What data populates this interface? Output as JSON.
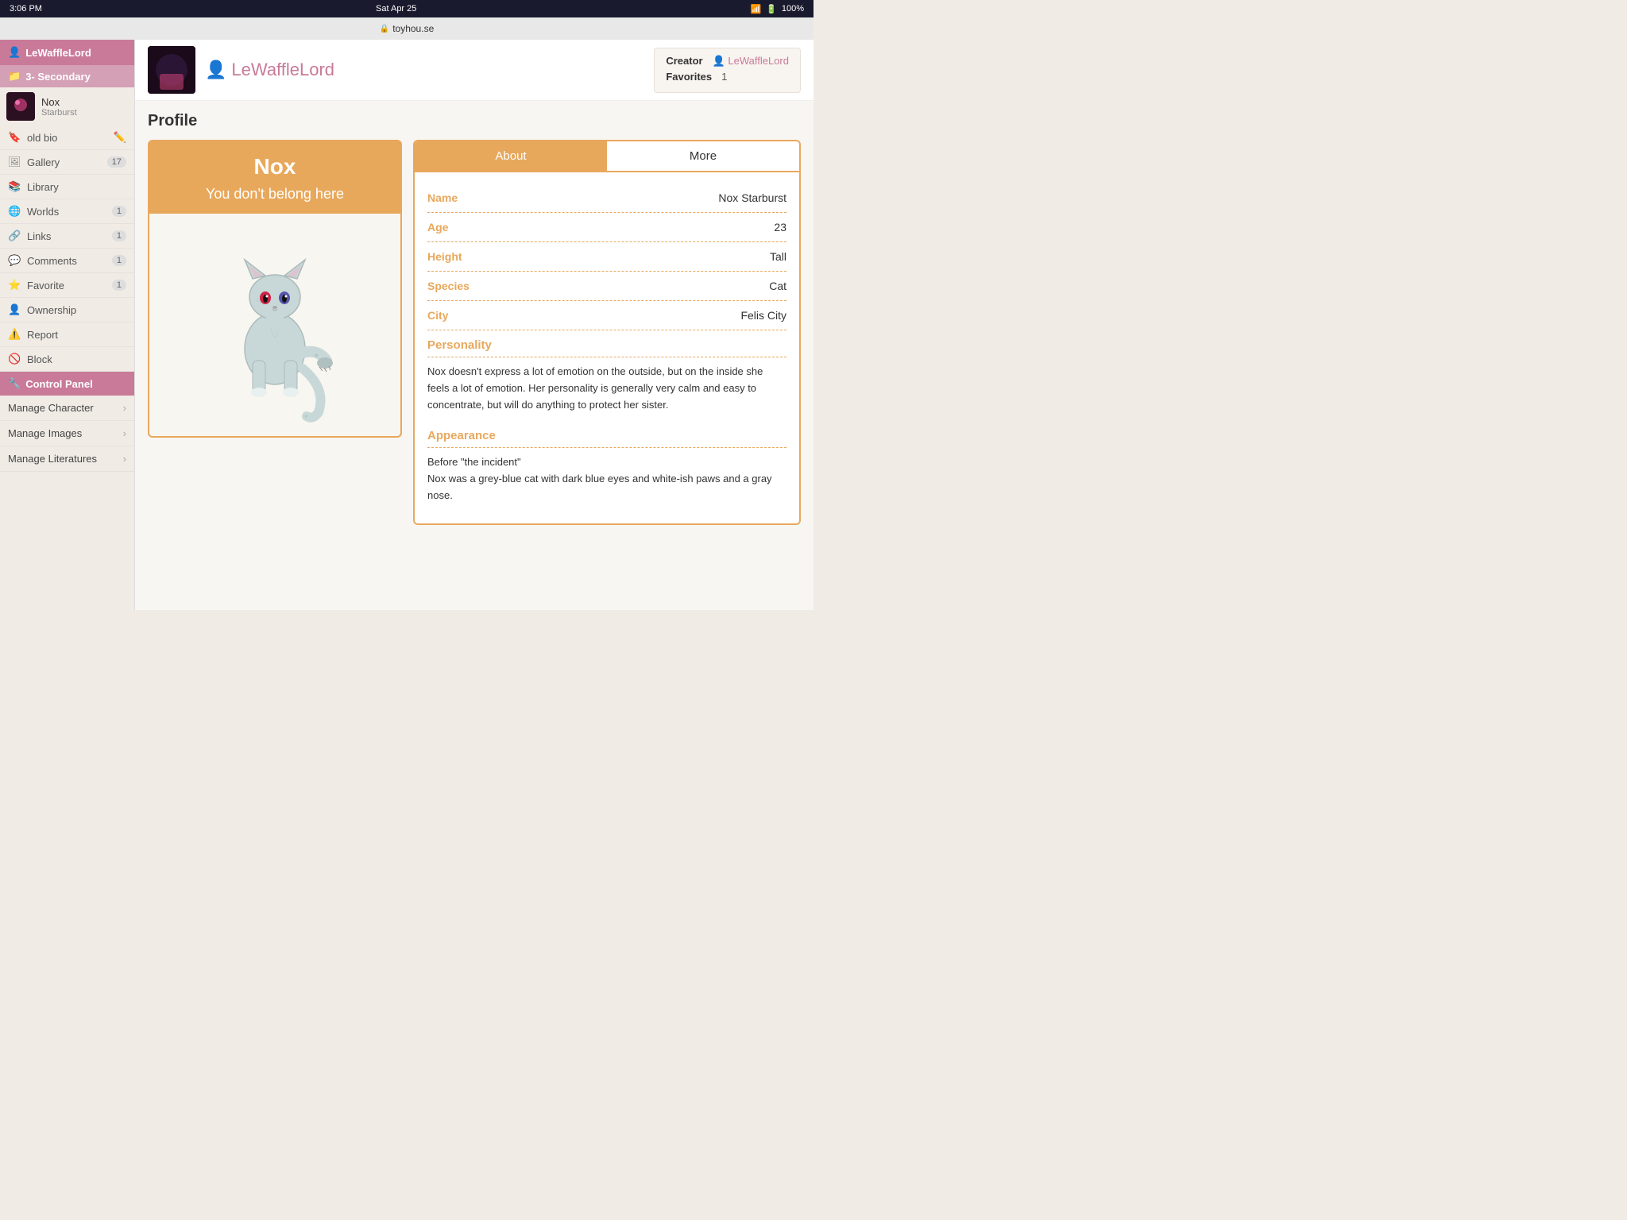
{
  "statusBar": {
    "time": "3:06 PM",
    "date": "Sat Apr 25",
    "battery": "100%",
    "domain": "toyhou.se"
  },
  "sidebar": {
    "username": "LeWaffleLord",
    "folder": "3- Secondary",
    "character": {
      "name": "Nox",
      "subtext": "Starburst"
    },
    "navItems": [
      {
        "icon": "🔖",
        "label": "old bio",
        "badge": "",
        "hasEdit": true
      },
      {
        "icon": "🖼",
        "label": "Gallery",
        "badge": "17"
      },
      {
        "icon": "📚",
        "label": "Library",
        "badge": ""
      },
      {
        "icon": "🌐",
        "label": "Worlds",
        "badge": "1"
      },
      {
        "icon": "🔗",
        "label": "Links",
        "badge": "1"
      },
      {
        "icon": "💬",
        "label": "Comments",
        "badge": "1"
      },
      {
        "icon": "⭐",
        "label": "Favorite",
        "badge": "1"
      },
      {
        "icon": "👤",
        "label": "Ownership",
        "badge": ""
      },
      {
        "icon": "⚠",
        "label": "Report",
        "badge": ""
      },
      {
        "icon": "🚫",
        "label": "Block",
        "badge": ""
      }
    ],
    "controlPanel": {
      "label": "Control Panel",
      "items": [
        {
          "label": "Manage Character"
        },
        {
          "label": "Manage Images"
        },
        {
          "label": "Manage Literatures"
        }
      ]
    }
  },
  "charHeader": {
    "name": "LeWaffleLord",
    "creator": "LeWaffleLord",
    "favorites": "1"
  },
  "profile": {
    "title": "Profile",
    "banner": {
      "charName": "Nox",
      "tagline": "You don't belong here"
    },
    "tabs": {
      "about": "About",
      "more": "More"
    },
    "fields": [
      {
        "label": "Name",
        "value": "Nox Starburst"
      },
      {
        "label": "Age",
        "value": "23"
      },
      {
        "label": "Height",
        "value": "Tall"
      },
      {
        "label": "Species",
        "value": "Cat"
      },
      {
        "label": "City",
        "value": "Felis City"
      }
    ],
    "sections": [
      {
        "header": "Personality",
        "text": "Nox doesn't express a lot of emotion on the outside, but on the inside she feels a lot of emotion. Her personality is generally very calm and easy to concentrate, but will do anything to protect her sister."
      },
      {
        "header": "Appearance",
        "text": "Before \"the incident\"\nNox was a grey-blue cat with dark blue eyes and white-ish paws and a gray nose."
      }
    ]
  }
}
